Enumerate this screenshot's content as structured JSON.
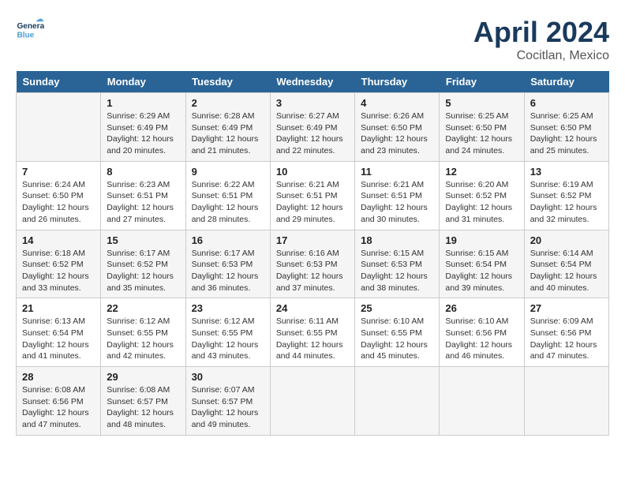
{
  "header": {
    "logo_general": "General",
    "logo_blue": "Blue",
    "month": "April 2024",
    "location": "Cocitlan, Mexico"
  },
  "days_of_week": [
    "Sunday",
    "Monday",
    "Tuesday",
    "Wednesday",
    "Thursday",
    "Friday",
    "Saturday"
  ],
  "weeks": [
    [
      {
        "day": "",
        "sunrise": "",
        "sunset": "",
        "daylight": ""
      },
      {
        "day": "1",
        "sunrise": "Sunrise: 6:29 AM",
        "sunset": "Sunset: 6:49 PM",
        "daylight": "Daylight: 12 hours and 20 minutes."
      },
      {
        "day": "2",
        "sunrise": "Sunrise: 6:28 AM",
        "sunset": "Sunset: 6:49 PM",
        "daylight": "Daylight: 12 hours and 21 minutes."
      },
      {
        "day": "3",
        "sunrise": "Sunrise: 6:27 AM",
        "sunset": "Sunset: 6:49 PM",
        "daylight": "Daylight: 12 hours and 22 minutes."
      },
      {
        "day": "4",
        "sunrise": "Sunrise: 6:26 AM",
        "sunset": "Sunset: 6:50 PM",
        "daylight": "Daylight: 12 hours and 23 minutes."
      },
      {
        "day": "5",
        "sunrise": "Sunrise: 6:25 AM",
        "sunset": "Sunset: 6:50 PM",
        "daylight": "Daylight: 12 hours and 24 minutes."
      },
      {
        "day": "6",
        "sunrise": "Sunrise: 6:25 AM",
        "sunset": "Sunset: 6:50 PM",
        "daylight": "Daylight: 12 hours and 25 minutes."
      }
    ],
    [
      {
        "day": "7",
        "sunrise": "Sunrise: 6:24 AM",
        "sunset": "Sunset: 6:50 PM",
        "daylight": "Daylight: 12 hours and 26 minutes."
      },
      {
        "day": "8",
        "sunrise": "Sunrise: 6:23 AM",
        "sunset": "Sunset: 6:51 PM",
        "daylight": "Daylight: 12 hours and 27 minutes."
      },
      {
        "day": "9",
        "sunrise": "Sunrise: 6:22 AM",
        "sunset": "Sunset: 6:51 PM",
        "daylight": "Daylight: 12 hours and 28 minutes."
      },
      {
        "day": "10",
        "sunrise": "Sunrise: 6:21 AM",
        "sunset": "Sunset: 6:51 PM",
        "daylight": "Daylight: 12 hours and 29 minutes."
      },
      {
        "day": "11",
        "sunrise": "Sunrise: 6:21 AM",
        "sunset": "Sunset: 6:51 PM",
        "daylight": "Daylight: 12 hours and 30 minutes."
      },
      {
        "day": "12",
        "sunrise": "Sunrise: 6:20 AM",
        "sunset": "Sunset: 6:52 PM",
        "daylight": "Daylight: 12 hours and 31 minutes."
      },
      {
        "day": "13",
        "sunrise": "Sunrise: 6:19 AM",
        "sunset": "Sunset: 6:52 PM",
        "daylight": "Daylight: 12 hours and 32 minutes."
      }
    ],
    [
      {
        "day": "14",
        "sunrise": "Sunrise: 6:18 AM",
        "sunset": "Sunset: 6:52 PM",
        "daylight": "Daylight: 12 hours and 33 minutes."
      },
      {
        "day": "15",
        "sunrise": "Sunrise: 6:17 AM",
        "sunset": "Sunset: 6:52 PM",
        "daylight": "Daylight: 12 hours and 35 minutes."
      },
      {
        "day": "16",
        "sunrise": "Sunrise: 6:17 AM",
        "sunset": "Sunset: 6:53 PM",
        "daylight": "Daylight: 12 hours and 36 minutes."
      },
      {
        "day": "17",
        "sunrise": "Sunrise: 6:16 AM",
        "sunset": "Sunset: 6:53 PM",
        "daylight": "Daylight: 12 hours and 37 minutes."
      },
      {
        "day": "18",
        "sunrise": "Sunrise: 6:15 AM",
        "sunset": "Sunset: 6:53 PM",
        "daylight": "Daylight: 12 hours and 38 minutes."
      },
      {
        "day": "19",
        "sunrise": "Sunrise: 6:15 AM",
        "sunset": "Sunset: 6:54 PM",
        "daylight": "Daylight: 12 hours and 39 minutes."
      },
      {
        "day": "20",
        "sunrise": "Sunrise: 6:14 AM",
        "sunset": "Sunset: 6:54 PM",
        "daylight": "Daylight: 12 hours and 40 minutes."
      }
    ],
    [
      {
        "day": "21",
        "sunrise": "Sunrise: 6:13 AM",
        "sunset": "Sunset: 6:54 PM",
        "daylight": "Daylight: 12 hours and 41 minutes."
      },
      {
        "day": "22",
        "sunrise": "Sunrise: 6:12 AM",
        "sunset": "Sunset: 6:55 PM",
        "daylight": "Daylight: 12 hours and 42 minutes."
      },
      {
        "day": "23",
        "sunrise": "Sunrise: 6:12 AM",
        "sunset": "Sunset: 6:55 PM",
        "daylight": "Daylight: 12 hours and 43 minutes."
      },
      {
        "day": "24",
        "sunrise": "Sunrise: 6:11 AM",
        "sunset": "Sunset: 6:55 PM",
        "daylight": "Daylight: 12 hours and 44 minutes."
      },
      {
        "day": "25",
        "sunrise": "Sunrise: 6:10 AM",
        "sunset": "Sunset: 6:55 PM",
        "daylight": "Daylight: 12 hours and 45 minutes."
      },
      {
        "day": "26",
        "sunrise": "Sunrise: 6:10 AM",
        "sunset": "Sunset: 6:56 PM",
        "daylight": "Daylight: 12 hours and 46 minutes."
      },
      {
        "day": "27",
        "sunrise": "Sunrise: 6:09 AM",
        "sunset": "Sunset: 6:56 PM",
        "daylight": "Daylight: 12 hours and 47 minutes."
      }
    ],
    [
      {
        "day": "28",
        "sunrise": "Sunrise: 6:08 AM",
        "sunset": "Sunset: 6:56 PM",
        "daylight": "Daylight: 12 hours and 47 minutes."
      },
      {
        "day": "29",
        "sunrise": "Sunrise: 6:08 AM",
        "sunset": "Sunset: 6:57 PM",
        "daylight": "Daylight: 12 hours and 48 minutes."
      },
      {
        "day": "30",
        "sunrise": "Sunrise: 6:07 AM",
        "sunset": "Sunset: 6:57 PM",
        "daylight": "Daylight: 12 hours and 49 minutes."
      },
      {
        "day": "",
        "sunrise": "",
        "sunset": "",
        "daylight": ""
      },
      {
        "day": "",
        "sunrise": "",
        "sunset": "",
        "daylight": ""
      },
      {
        "day": "",
        "sunrise": "",
        "sunset": "",
        "daylight": ""
      },
      {
        "day": "",
        "sunrise": "",
        "sunset": "",
        "daylight": ""
      }
    ]
  ]
}
